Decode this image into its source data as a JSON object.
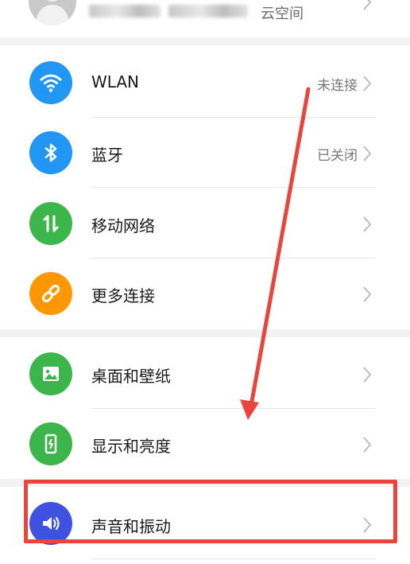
{
  "account": {
    "cloud_label": "云空间"
  },
  "settings": {
    "items": [
      {
        "label": "WLAN",
        "value": "未连接",
        "icon": "wifi-icon",
        "color": "#2196f3"
      },
      {
        "label": "蓝牙",
        "value": "已关闭",
        "icon": "bluetooth-icon",
        "color": "#2196f3"
      },
      {
        "label": "移动网络",
        "value": "",
        "icon": "mobile-network-icon",
        "color": "#3cb54a"
      },
      {
        "label": "更多连接",
        "value": "",
        "icon": "link-icon",
        "color": "#ff9800"
      },
      {
        "label": "桌面和壁纸",
        "value": "",
        "icon": "wallpaper-icon",
        "color": "#3cb54a"
      },
      {
        "label": "显示和亮度",
        "value": "",
        "icon": "display-icon",
        "color": "#3cb54a"
      },
      {
        "label": "声音和振动",
        "value": "",
        "icon": "sound-icon",
        "color": "#3f51e0"
      }
    ]
  },
  "annotation": {
    "color": "#e8453c"
  }
}
